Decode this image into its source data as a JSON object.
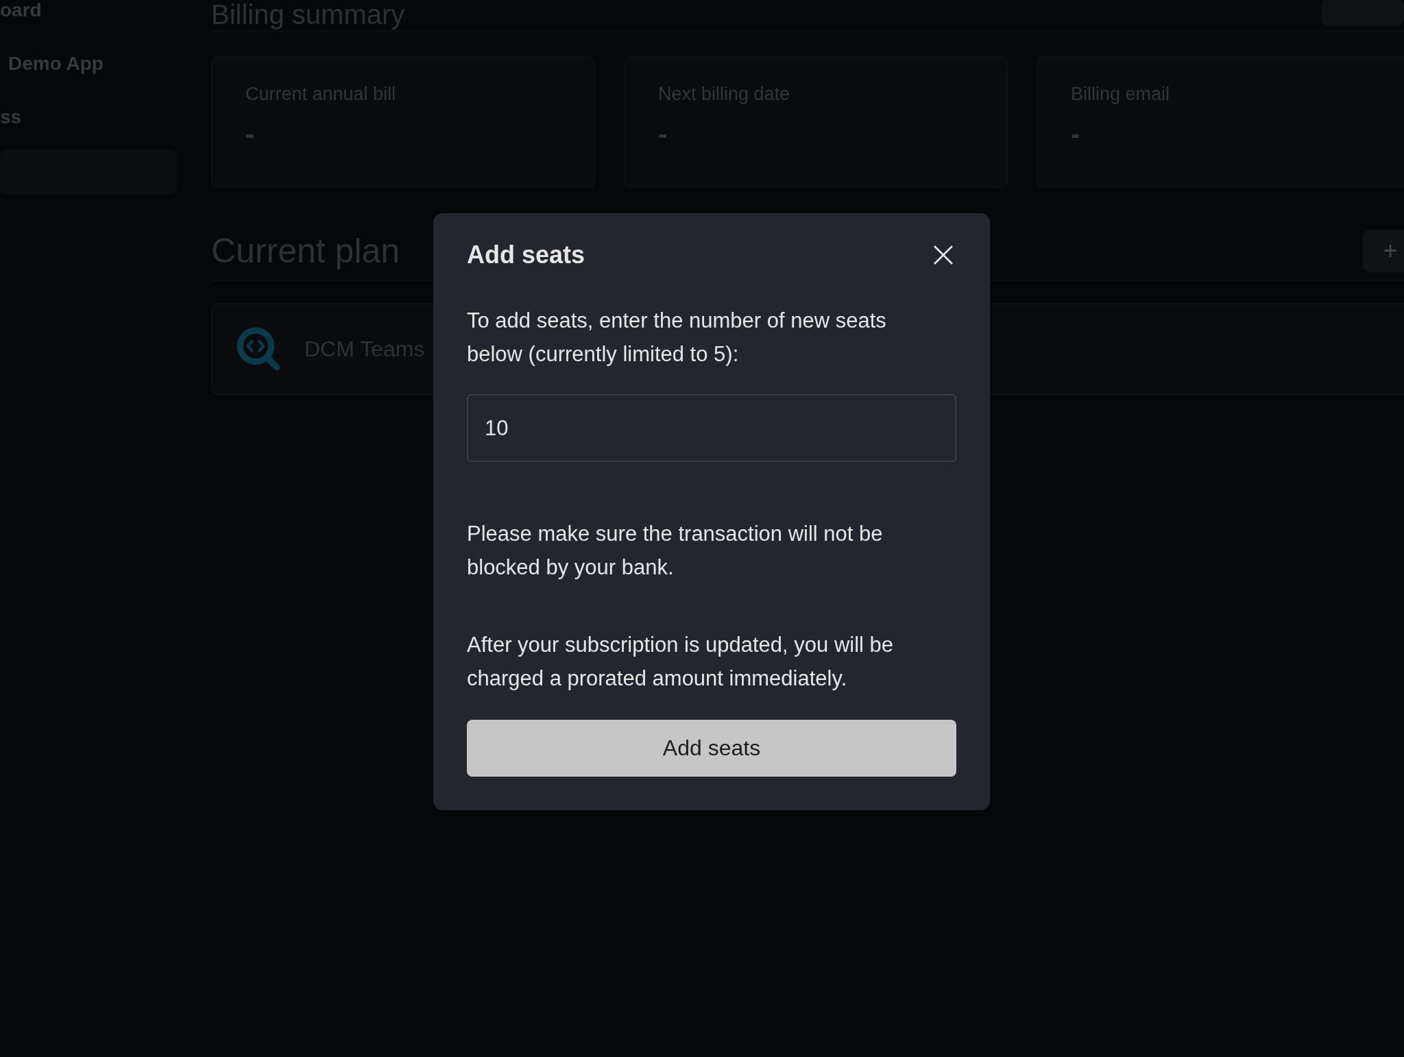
{
  "sidebar": {
    "items": [
      {
        "label": "oard",
        "selected": false
      },
      {
        "label": "Demo App",
        "selected": false
      },
      {
        "label": "ss",
        "selected": false
      },
      {
        "selected": true
      }
    ]
  },
  "billing_summary": {
    "title": "Billing summary",
    "cards": [
      {
        "label": "Current annual bill",
        "value": "-"
      },
      {
        "label": "Next billing date",
        "value": "-"
      },
      {
        "label": "Billing email",
        "value": "-"
      }
    ]
  },
  "current_plan": {
    "title": "Current plan",
    "add_button": "+",
    "plan": {
      "name": "DCM Teams"
    }
  },
  "modal": {
    "title": "Add seats",
    "paragraphs": [
      "To add seats, enter the number of new seats below (currently limited to 5):"
    ],
    "input": {
      "value": "10"
    },
    "notes": [
      "Please make sure the transaction will not be blocked by your bank.",
      "After your subscription is updated, you will be charged a prorated amount immediately."
    ],
    "button": "Add seats"
  }
}
